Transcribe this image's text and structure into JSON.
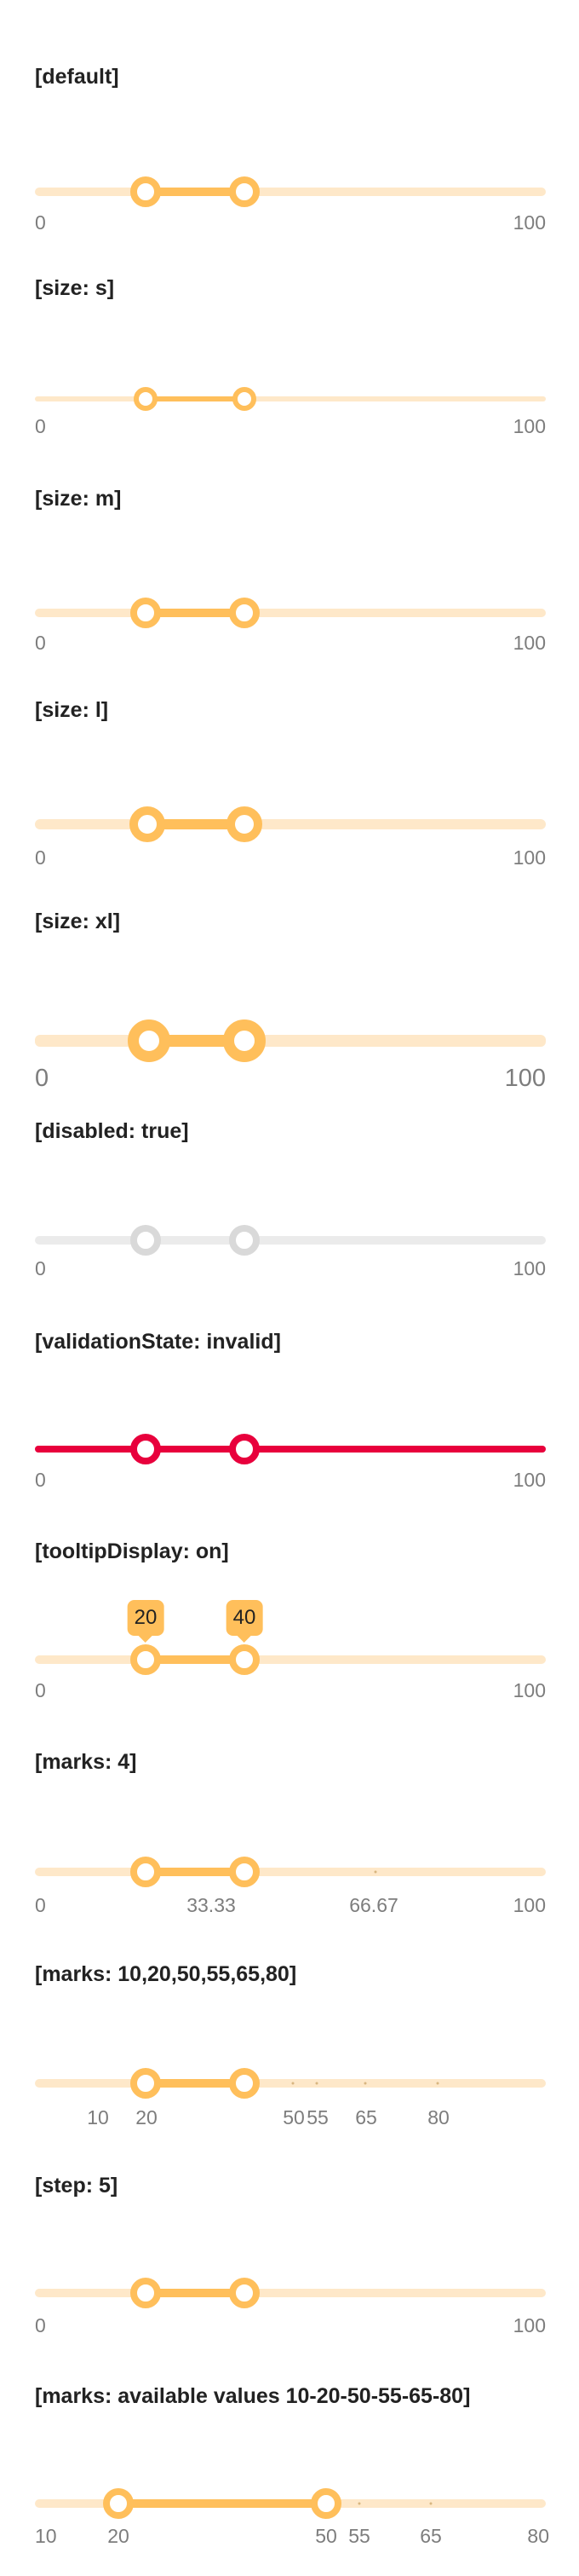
{
  "colors": {
    "accent": "#ffbf5b",
    "track": "#fee8c9",
    "disabled_track": "#ebebeb",
    "disabled_thumb": "#d9d9d9",
    "invalid": "#e8003c",
    "label_text": "#222222",
    "tick_text": "#7d7d7d"
  },
  "sections": [
    {
      "label": "[default]",
      "min_label": "0",
      "max_label": "100",
      "range_values": [
        20,
        40
      ]
    },
    {
      "label": "[size: s]",
      "min_label": "0",
      "max_label": "100",
      "range_values": [
        20,
        40
      ]
    },
    {
      "label": "[size: m]",
      "min_label": "0",
      "max_label": "100",
      "range_values": [
        20,
        40
      ]
    },
    {
      "label": "[size: l]",
      "min_label": "0",
      "max_label": "100",
      "range_values": [
        20,
        40
      ]
    },
    {
      "label": "[size: xl]",
      "min_label": "0",
      "max_label": "100",
      "range_values": [
        20,
        40
      ]
    },
    {
      "label": "[disabled: true]",
      "min_label": "0",
      "max_label": "100",
      "range_values": [
        20,
        40
      ]
    },
    {
      "label": "[validationState: invalid]",
      "min_label": "0",
      "max_label": "100",
      "range_values": [
        20,
        40
      ]
    },
    {
      "label": "[tooltipDisplay: on]",
      "min_label": "0",
      "max_label": "100",
      "tooltip_start": "20",
      "tooltip_end": "40",
      "range_values": [
        20,
        40
      ]
    },
    {
      "label": "[marks: 4]",
      "ticks": [
        "0",
        "33.33",
        "66.67",
        "100"
      ],
      "range_values": [
        20,
        40
      ]
    },
    {
      "label": "[marks: 10,20,50,55,65,80]",
      "ticks": [
        "10",
        "20",
        "50",
        "55",
        "65",
        "80"
      ],
      "range_values": [
        20,
        40
      ]
    },
    {
      "label": "[step: 5]",
      "min_label": "0",
      "max_label": "100",
      "range_values": [
        20,
        40
      ]
    },
    {
      "label": "[marks: available values 10-20-50-55-65-80]",
      "ticks": [
        "10",
        "20",
        "50",
        "55",
        "65",
        "80"
      ],
      "range_values": [
        20,
        50
      ]
    }
  ]
}
